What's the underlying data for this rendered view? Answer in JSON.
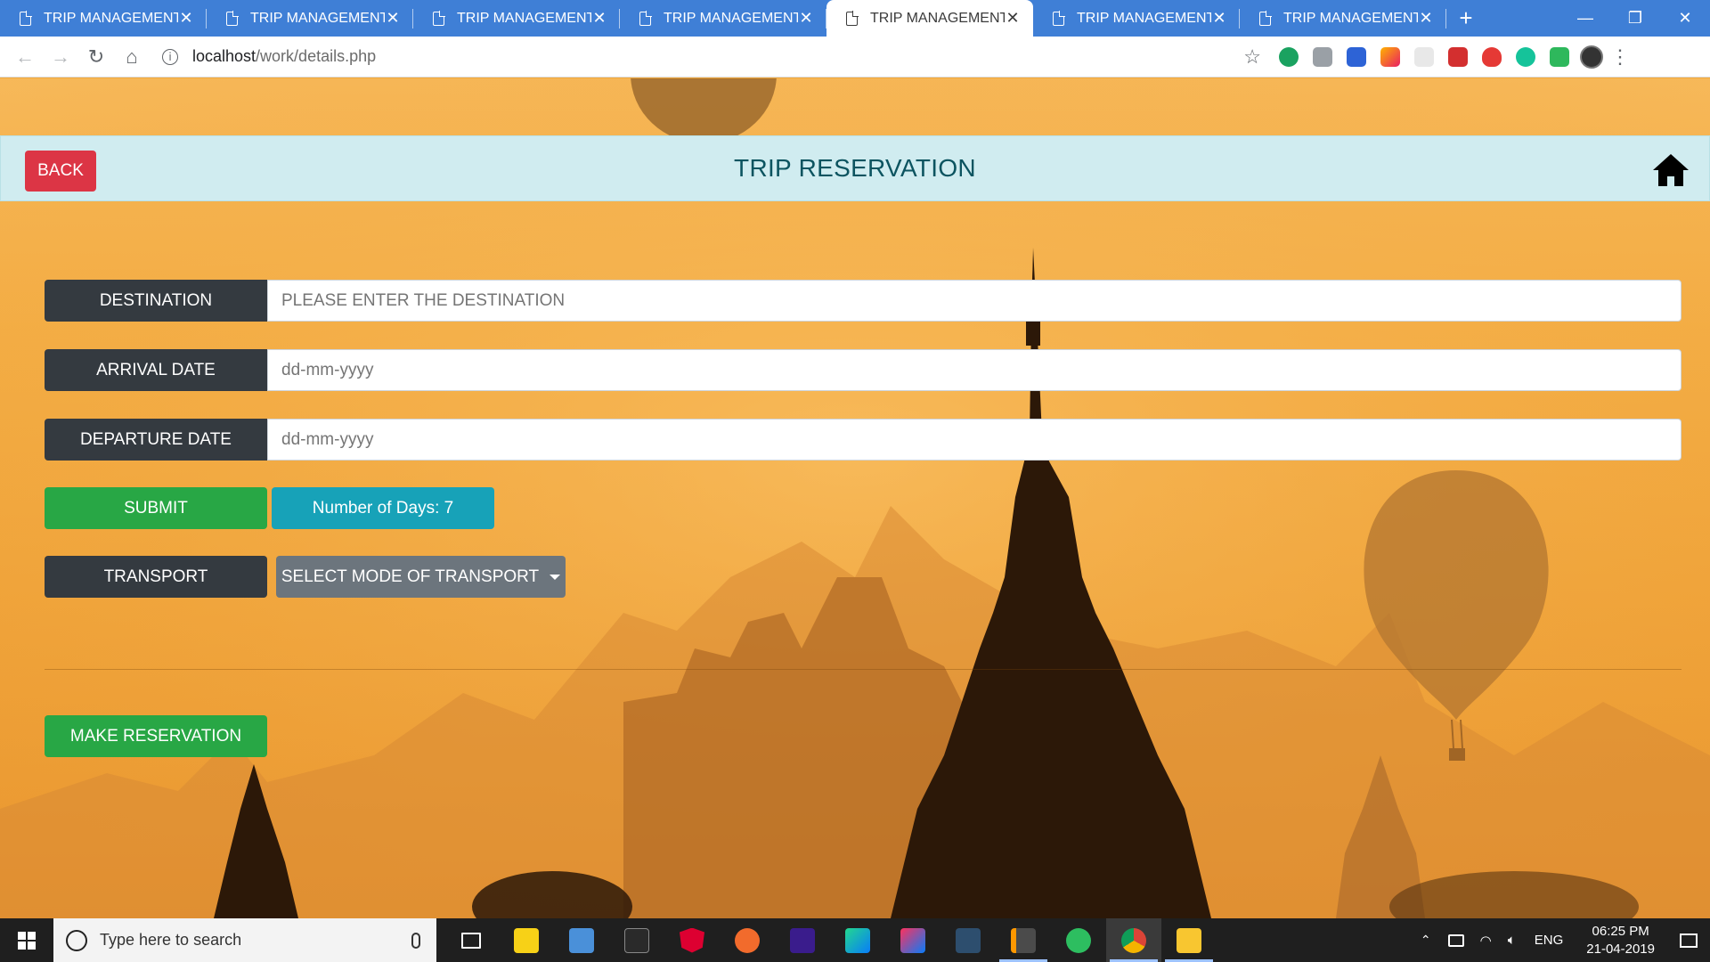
{
  "browser": {
    "tabs": [
      {
        "title": "TRIP MANAGEMENT",
        "active": false
      },
      {
        "title": "TRIP MANAGEMENT",
        "active": false
      },
      {
        "title": "TRIP MANAGEMENT",
        "active": false
      },
      {
        "title": "TRIP MANAGEMENT",
        "active": false
      },
      {
        "title": "TRIP MANAGEMENT",
        "active": true
      },
      {
        "title": "TRIP MANAGEMENT",
        "active": false
      },
      {
        "title": "TRIP MANAGEMENT",
        "active": false
      }
    ],
    "url_host": "localhost",
    "url_path": "/work/details.php",
    "new_tab": "+",
    "close_glyph": "✕"
  },
  "header": {
    "back_label": "BACK",
    "title": "TRIP RESERVATION"
  },
  "form": {
    "destination_label": "DESTINATION",
    "destination_placeholder": "PLEASE ENTER THE DESTINATION",
    "arrival_label": "ARRIVAL DATE",
    "arrival_placeholder": "dd-mm-yyyy",
    "departure_label": "DEPARTURE DATE",
    "departure_placeholder": "dd-mm-yyyy",
    "submit_label": "SUBMIT",
    "days_text": "Number of Days: 7",
    "transport_label": "TRANSPORT",
    "transport_select": "SELECT MODE OF TRANSPORT",
    "reserve_label": "MAKE RESERVATION"
  },
  "taskbar": {
    "search_placeholder": "Type here to search",
    "language": "ENG",
    "time": "06:25 PM",
    "date": "21-04-2019"
  },
  "colors": {
    "danger": "#dc3545",
    "success": "#28a745",
    "info": "#17a2b8",
    "secondary": "#6c757d",
    "dark": "#343a40",
    "header_bg": "#d0ecf0",
    "title_text": "#0c5460"
  }
}
